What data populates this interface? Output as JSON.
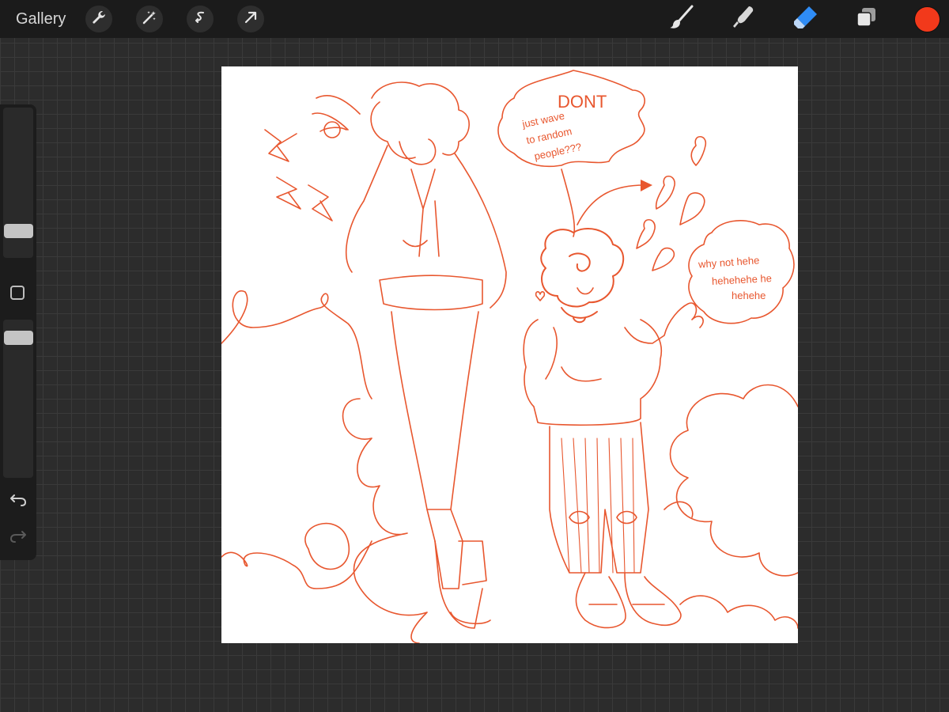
{
  "topbar": {
    "gallery_label": "Gallery",
    "left_tools": [
      "wrench-icon",
      "magic-wand-icon",
      "selection-icon",
      "transform-arrow-icon"
    ],
    "right_tools": [
      "brush-icon",
      "smudge-icon",
      "eraser-icon",
      "layers-icon"
    ],
    "active_tool": "eraser",
    "current_color": "#f2391b"
  },
  "sidebar": {
    "brush_size_level": 0.25,
    "opacity_level": 0.07,
    "undo_icon": "undo-icon",
    "redo_icon": "redo-icon"
  },
  "canvas": {
    "stroke_color": "#e8572f",
    "speech_bubble_top": {
      "line1": "DONT",
      "line2": "just wave",
      "line3": "to random",
      "line4": "people???"
    },
    "speech_bubble_right": {
      "line1": "why not hehe",
      "line2": "hehehehe he",
      "line3": "hehehe"
    }
  }
}
